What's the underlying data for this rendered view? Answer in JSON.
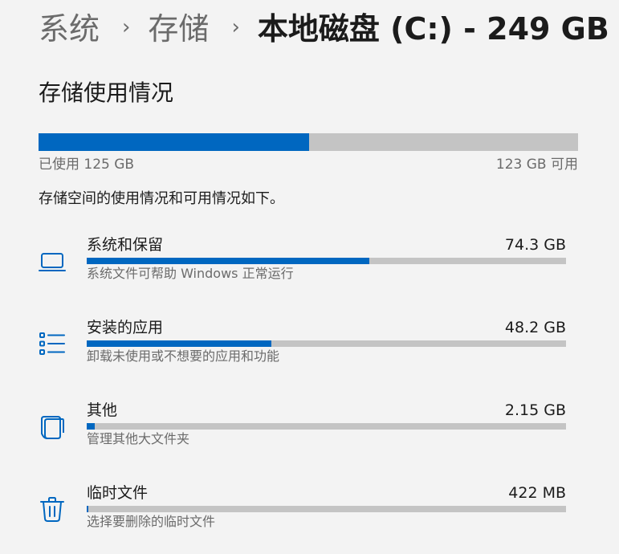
{
  "breadcrumb": {
    "level1": "系统",
    "level2": "存储",
    "current": "本地磁盘 (C:) - 249 GB",
    "separator": "›"
  },
  "usage": {
    "section_title": "存储使用情况",
    "used_label": "已使用 125 GB",
    "free_label": "123 GB 可用",
    "used_fraction": 0.502,
    "description": "存储空间的使用情况和可用情况如下。"
  },
  "categories": [
    {
      "name": "系统和保留",
      "size": "74.3 GB",
      "subtitle": "系统文件可帮助 Windows 正常运行",
      "icon": "laptop-icon",
      "fraction": 0.59
    },
    {
      "name": "安装的应用",
      "size": "48.2 GB",
      "subtitle": "卸载未使用或不想要的应用和功能",
      "icon": "list-icon",
      "fraction": 0.385
    },
    {
      "name": "其他",
      "size": "2.15 GB",
      "subtitle": "管理其他大文件夹",
      "icon": "folder-icon",
      "fraction": 0.017
    },
    {
      "name": "临时文件",
      "size": "422 MB",
      "subtitle": "选择要删除的临时文件",
      "icon": "trash-icon",
      "fraction": 0.0034
    }
  ],
  "colors": {
    "accent": "#0067c0",
    "bar_track": "#c4c4c4",
    "background": "#f3f3f3"
  }
}
